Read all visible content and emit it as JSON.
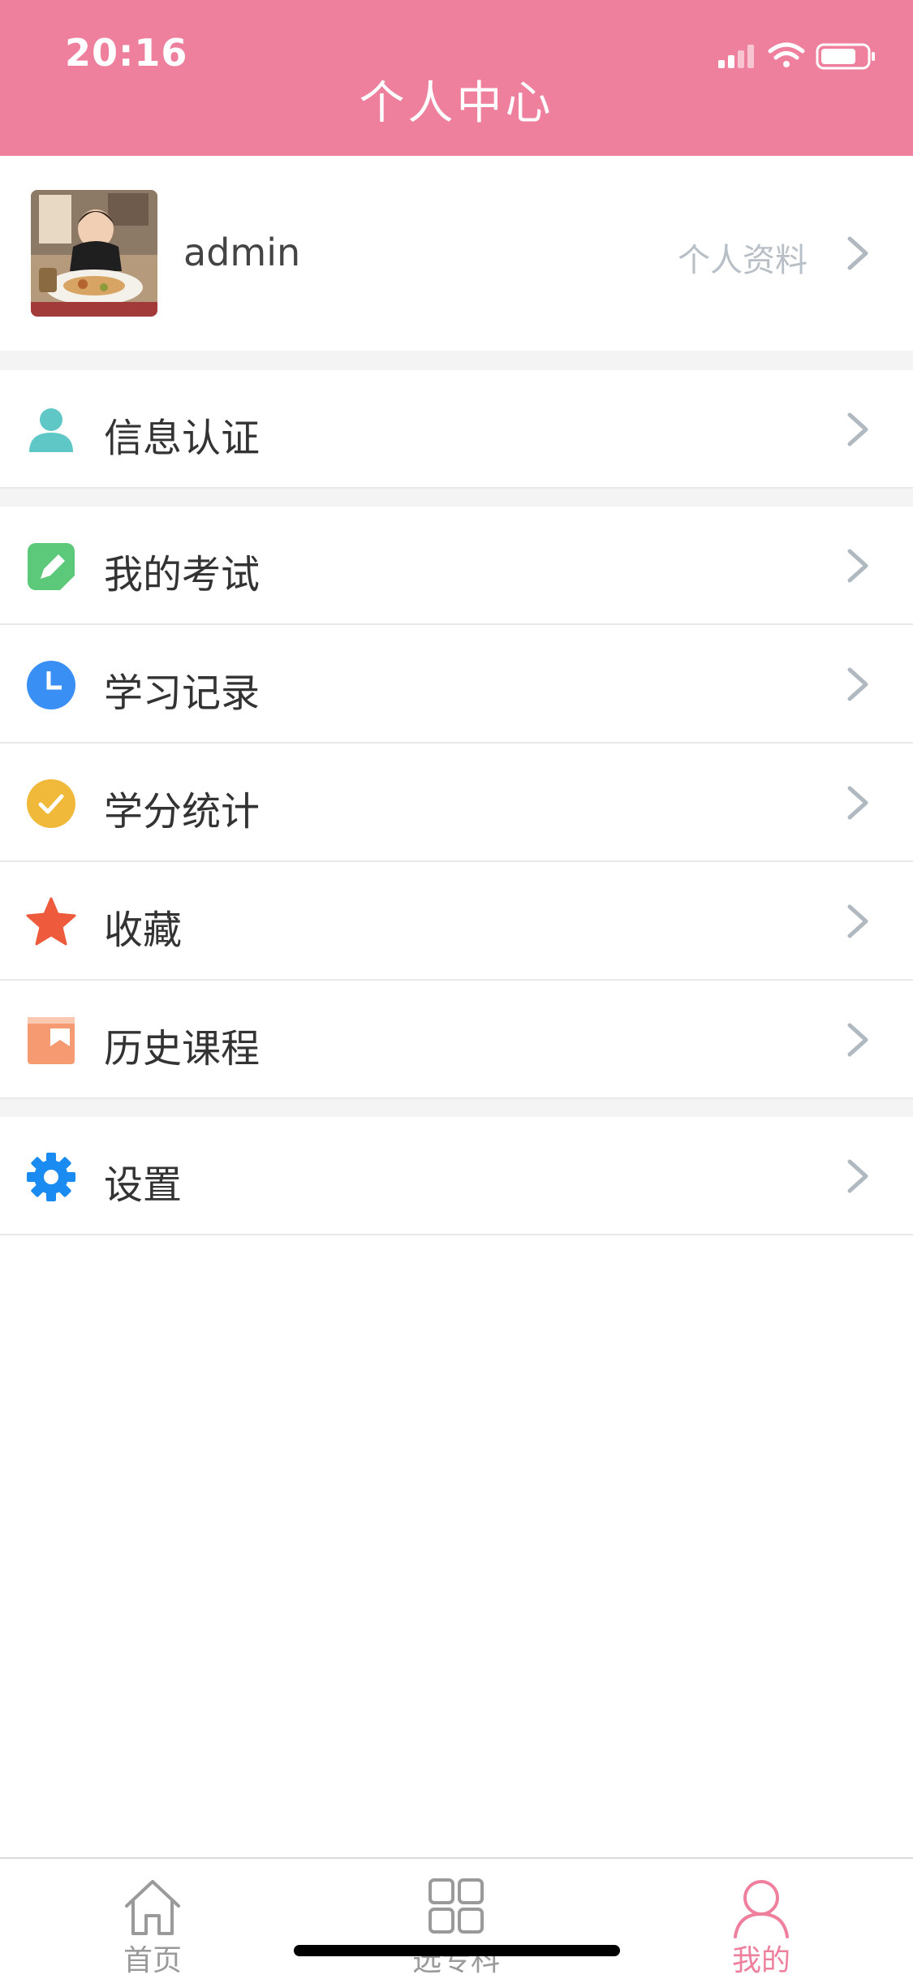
{
  "status_bar": {
    "time": "20:16"
  },
  "header": {
    "title": "个人中心"
  },
  "profile": {
    "username": "admin",
    "link_label": "个人资料"
  },
  "menu": {
    "info_auth": "信息认证",
    "my_exams": "我的考试",
    "study_records": "学习记录",
    "credit_stats": "学分统计",
    "favorites": "收藏",
    "history_courses": "历史课程",
    "settings": "设置"
  },
  "tabbar": {
    "home": "首页",
    "select_subject": "选专科",
    "mine": "我的"
  },
  "colors": {
    "brand": "#ee7f9d",
    "teal": "#5fc8c6",
    "green": "#5cc97a",
    "blue": "#3a8ff5",
    "yellow": "#f1b93a",
    "red": "#ee5b3c",
    "peach": "#f69a72",
    "gear_blue": "#1a8bf0"
  },
  "icons": {
    "info_auth": "person-icon",
    "my_exams": "edit-icon",
    "study_records": "clock-icon",
    "credit_stats": "check-circle-icon",
    "favorites": "star-icon",
    "history_courses": "book-icon",
    "settings": "gear-icon"
  }
}
